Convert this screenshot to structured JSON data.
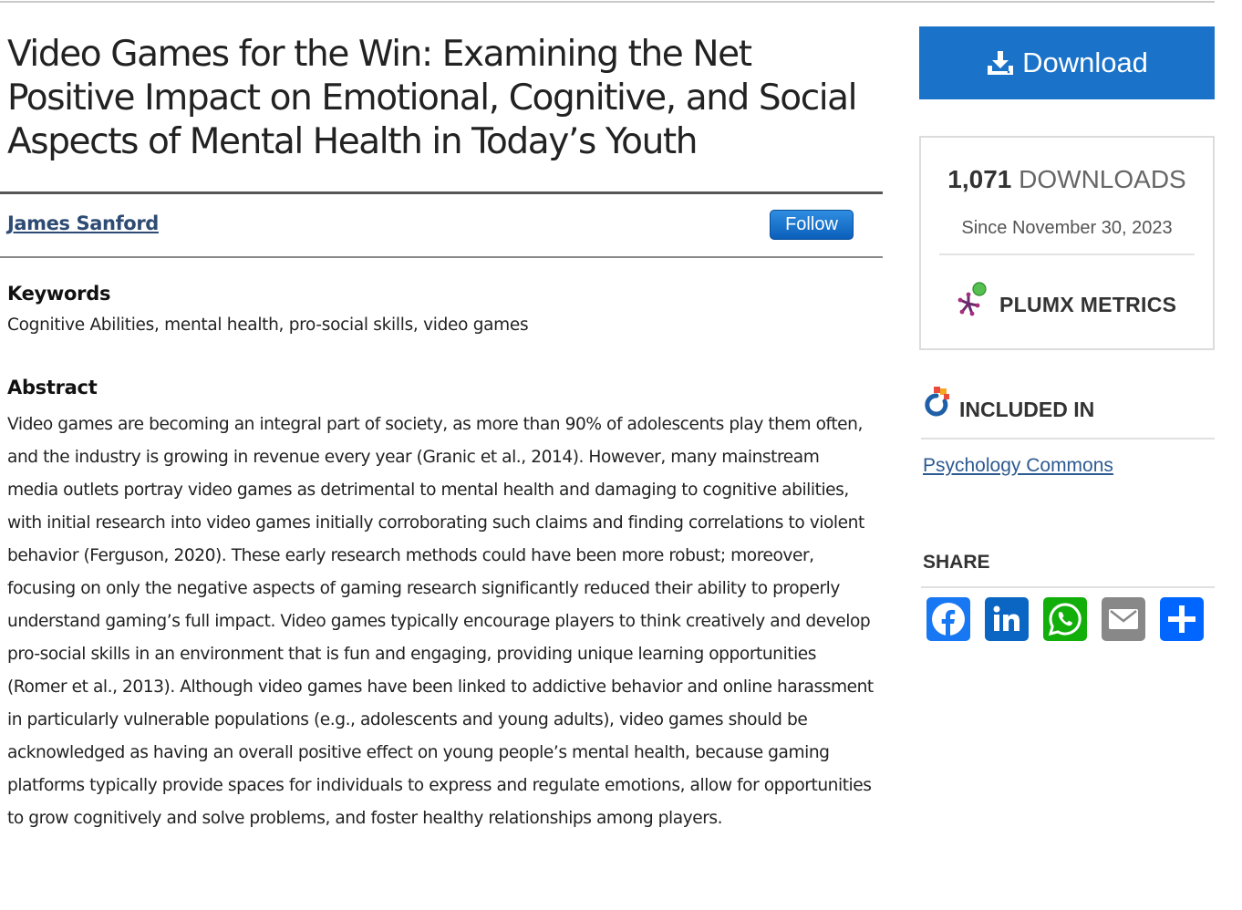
{
  "paper": {
    "title": "Video Games for the Win: Examining the Net Positive Impact on Emotional, Cognitive, and Social Aspects of Mental Health in Today’s Youth",
    "author": "James Sanford",
    "follow_label": "Follow",
    "keywords_heading": "Keywords",
    "keywords": "Cognitive Abilities, mental health, pro-social skills, video games",
    "abstract_heading": "Abstract",
    "abstract": "Video games are becoming an integral part of society, as more than 90% of adolescents play them often, and the industry is growing in revenue every year (Granic et al., 2014). However, many mainstream media outlets portray video games as detrimental to mental health and damaging to cognitive abilities, with initial research into video games initially corroborating such claims and finding correlations to violent behavior (Ferguson, 2020). These early research methods could have been more robust; moreover, focusing on only the negative aspects of gaming research significantly reduced their ability to properly understand gaming’s full impact. Video games typically encourage players to think creatively and develop pro-social skills in an environment that is fun and engaging, providing unique learning opportunities (Romer et al., 2013). Although video games have been linked to addictive behavior and online harassment in particularly vulnerable populations (e.g., adolescents and young adults), video games should be acknowledged as having an overall positive effect on young people’s mental health, because gaming platforms typically provide spaces for individuals to express and regulate emotions, allow for opportunities to grow cognitively and solve problems, and foster healthy relationships among players."
  },
  "sidebar": {
    "download_label": "Download",
    "download_color": "#1a73c9",
    "downloads_count": "1,071",
    "downloads_label": "DOWNLOADS",
    "since": "Since November 30, 2023",
    "plumx_label": "PLUMX METRICS",
    "included_label": "INCLUDED IN",
    "included_link": "Psychology Commons",
    "share_label": "SHARE",
    "share_icons": [
      "facebook-icon",
      "linkedin-icon",
      "whatsapp-icon",
      "email-icon",
      "share-plus-icon"
    ]
  }
}
